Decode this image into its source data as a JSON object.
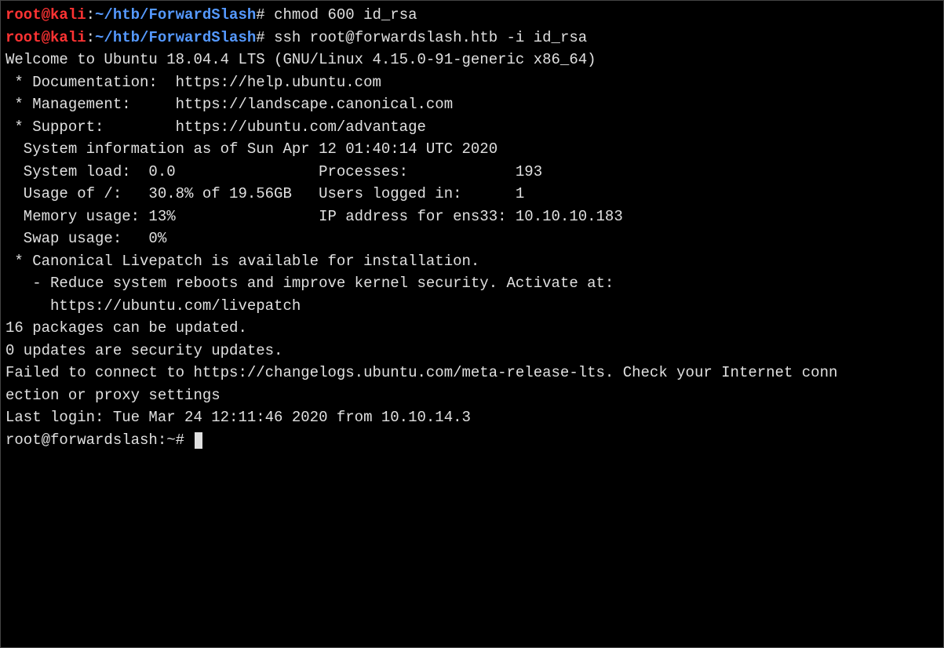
{
  "prompt1": {
    "user_host": "root@kali",
    "colon": ":",
    "path": "~/htb/ForwardSlash",
    "hash": "#",
    "command": "chmod 600 id_rsa"
  },
  "prompt2": {
    "user_host": "root@kali",
    "colon": ":",
    "path": "~/htb/ForwardSlash",
    "hash": "#",
    "command": "ssh root@forwardslash.htb -i id_rsa"
  },
  "welcome": "Welcome to Ubuntu 18.04.4 LTS (GNU/Linux 4.15.0-91-generic x86_64)",
  "blank": "",
  "doc_line": " * Documentation:  https://help.ubuntu.com",
  "mgmt_line": " * Management:     https://landscape.canonical.com",
  "support_line": " * Support:        https://ubuntu.com/advantage",
  "sysinfo_header": "  System information as of Sun Apr 12 01:40:14 UTC 2020",
  "stat1": "  System load:  0.0                Processes:            193",
  "stat2": "  Usage of /:   30.8% of 19.56GB   Users logged in:      1",
  "stat3": "  Memory usage: 13%                IP address for ens33: 10.10.10.183",
  "stat4": "  Swap usage:   0%",
  "livepatch1": " * Canonical Livepatch is available for installation.",
  "livepatch2": "   - Reduce system reboots and improve kernel security. Activate at:",
  "livepatch3": "     https://ubuntu.com/livepatch",
  "updates1": "16 packages can be updated.",
  "updates2": "0 updates are security updates.",
  "fail1": "Failed to connect to https://changelogs.ubuntu.com/meta-release-lts. Check your Internet conn",
  "fail2": "ection or proxy settings",
  "lastlogin": "Last login: Tue Mar 24 12:11:46 2020 from 10.10.14.3",
  "final_prompt": "root@forwardslash:~# "
}
